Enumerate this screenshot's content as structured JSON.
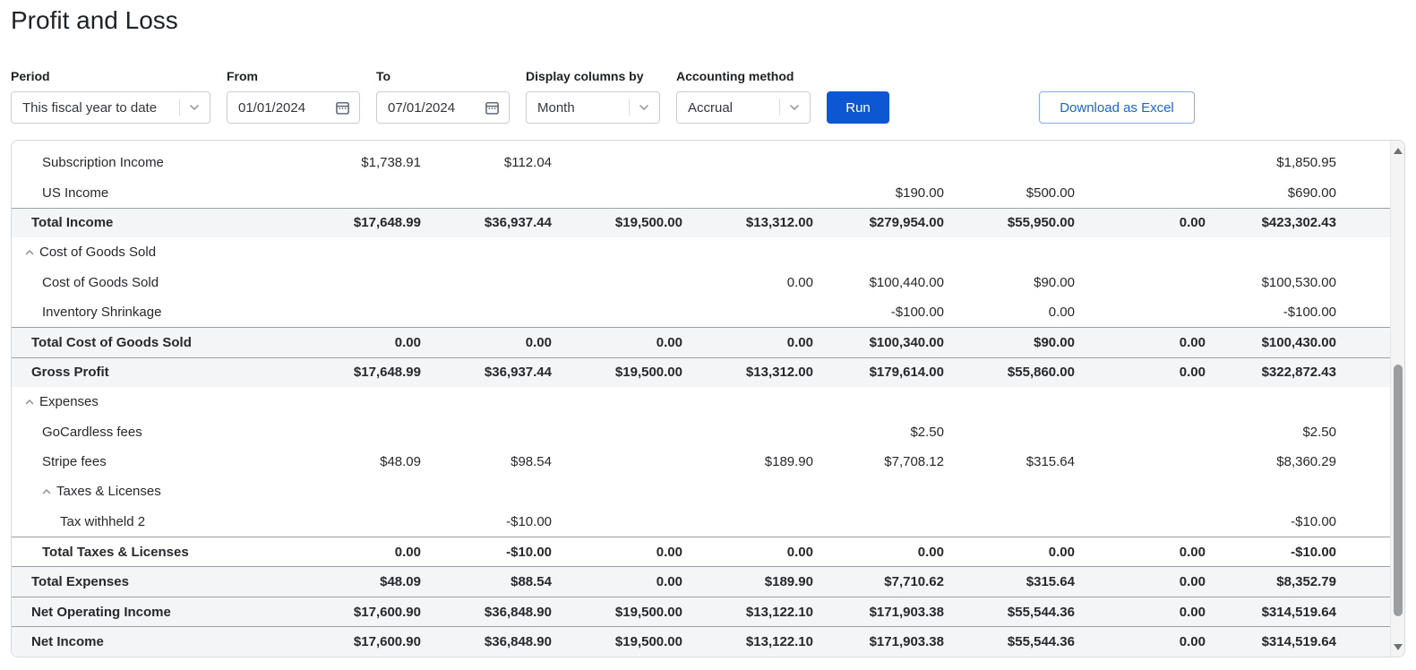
{
  "page": {
    "title": "Profit and Loss"
  },
  "filters": {
    "period": {
      "label": "Period",
      "value": "This fiscal year to date"
    },
    "from": {
      "label": "From",
      "value": "01/01/2024"
    },
    "to": {
      "label": "To",
      "value": "07/01/2024"
    },
    "display_columns_by": {
      "label": "Display columns by",
      "value": "Month"
    },
    "accounting_method": {
      "label": "Accounting method",
      "value": "Accrual"
    },
    "run_label": "Run",
    "download_label": "Download as Excel"
  },
  "icons": {
    "period_dropdown": "chevron-down-icon",
    "date_picker": "calendar-icon",
    "collapse_row": "chevron-up-icon",
    "scroll_up": "triangle-up-icon",
    "scroll_down": "triangle-down-icon"
  },
  "colors": {
    "accent": "#0d57d2",
    "link": "#1766d9",
    "link_border": "#86ace9",
    "total_row_bg": "#f4f5f6",
    "border_strong": "#9aa0a6",
    "border_light": "#d5d8dc",
    "text": "#26282d",
    "caret": "#8c9096",
    "scrollbar_thumb": "#9b9ea1"
  },
  "report": {
    "rows": [
      {
        "label": "Subscription Income",
        "level": 1,
        "type": "item",
        "collapsible": false,
        "values": [
          "$1,738.91",
          "$112.04",
          "",
          "",
          "",
          "",
          "",
          "$1,850.95"
        ]
      },
      {
        "label": "US Income",
        "level": 1,
        "type": "item",
        "collapsible": false,
        "values": [
          "",
          "",
          "",
          "",
          "$190.00",
          "$500.00",
          "",
          "$690.00"
        ]
      },
      {
        "label": "Total Income",
        "level": 0,
        "type": "total",
        "collapsible": false,
        "values": [
          "$17,648.99",
          "$36,937.44",
          "$19,500.00",
          "$13,312.00",
          "$279,954.00",
          "$55,950.00",
          "0.00",
          "$423,302.43"
        ]
      },
      {
        "label": "Cost of Goods Sold",
        "level": 0,
        "type": "section",
        "collapsible": true,
        "values": [
          "",
          "",
          "",
          "",
          "",
          "",
          "",
          ""
        ]
      },
      {
        "label": "Cost of Goods Sold",
        "level": 1,
        "type": "item",
        "collapsible": false,
        "values": [
          "",
          "",
          "",
          "0.00",
          "$100,440.00",
          "$90.00",
          "",
          "$100,530.00"
        ]
      },
      {
        "label": "Inventory Shrinkage",
        "level": 1,
        "type": "item",
        "collapsible": false,
        "values": [
          "",
          "",
          "",
          "",
          "-$100.00",
          "0.00",
          "",
          "-$100.00"
        ]
      },
      {
        "label": "Total Cost of Goods Sold",
        "level": 0,
        "type": "total",
        "collapsible": false,
        "values": [
          "0.00",
          "0.00",
          "0.00",
          "0.00",
          "$100,340.00",
          "$90.00",
          "0.00",
          "$100,430.00"
        ]
      },
      {
        "label": "Gross Profit",
        "level": 0,
        "type": "total",
        "collapsible": false,
        "values": [
          "$17,648.99",
          "$36,937.44",
          "$19,500.00",
          "$13,312.00",
          "$179,614.00",
          "$55,860.00",
          "0.00",
          "$322,872.43"
        ]
      },
      {
        "label": "Expenses",
        "level": 0,
        "type": "section",
        "collapsible": true,
        "values": [
          "",
          "",
          "",
          "",
          "",
          "",
          "",
          ""
        ]
      },
      {
        "label": "GoCardless fees",
        "level": 1,
        "type": "item",
        "collapsible": false,
        "values": [
          "",
          "",
          "",
          "",
          "$2.50",
          "",
          "",
          "$2.50"
        ]
      },
      {
        "label": "Stripe fees",
        "level": 1,
        "type": "item",
        "collapsible": false,
        "values": [
          "$48.09",
          "$98.54",
          "",
          "$189.90",
          "$7,708.12",
          "$315.64",
          "",
          "$8,360.29"
        ]
      },
      {
        "label": "Taxes & Licenses",
        "level": 1,
        "type": "section",
        "collapsible": true,
        "values": [
          "",
          "",
          "",
          "",
          "",
          "",
          "",
          ""
        ]
      },
      {
        "label": "Tax withheld 2",
        "level": 2,
        "type": "item",
        "collapsible": false,
        "values": [
          "",
          "-$10.00",
          "",
          "",
          "",
          "",
          "",
          "-$10.00"
        ]
      },
      {
        "label": "Total Taxes & Licenses",
        "level": 1,
        "type": "subtotal",
        "collapsible": false,
        "values": [
          "0.00",
          "-$10.00",
          "0.00",
          "0.00",
          "0.00",
          "0.00",
          "0.00",
          "-$10.00"
        ]
      },
      {
        "label": "Total Expenses",
        "level": 0,
        "type": "total",
        "collapsible": false,
        "values": [
          "$48.09",
          "$88.54",
          "0.00",
          "$189.90",
          "$7,710.62",
          "$315.64",
          "0.00",
          "$8,352.79"
        ]
      },
      {
        "label": "Net Operating Income",
        "level": 0,
        "type": "total",
        "collapsible": false,
        "values": [
          "$17,600.90",
          "$36,848.90",
          "$19,500.00",
          "$13,122.10",
          "$171,903.38",
          "$55,544.36",
          "0.00",
          "$314,519.64"
        ]
      },
      {
        "label": "Net Income",
        "level": 0,
        "type": "total",
        "collapsible": false,
        "values": [
          "$17,600.90",
          "$36,848.90",
          "$19,500.00",
          "$13,122.10",
          "$171,903.38",
          "$55,544.36",
          "0.00",
          "$314,519.64"
        ]
      }
    ]
  }
}
